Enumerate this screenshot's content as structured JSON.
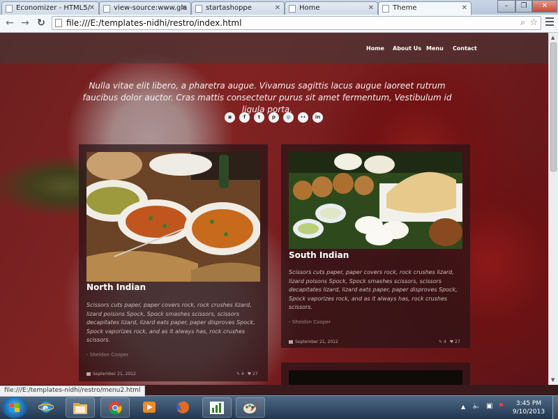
{
  "browser": {
    "tabs": [
      {
        "title": "Economizer - HTML5/"
      },
      {
        "title": "view-source:www.gla"
      },
      {
        "title": "startashoppe"
      },
      {
        "title": "Home"
      },
      {
        "title": "Theme"
      }
    ],
    "address": "file:///E:/templates-nidhi/restro/index.html",
    "status_url": "file:///E:/templates-nidhi/restro/menu2.html"
  },
  "site": {
    "nav": [
      "Home",
      "About Us",
      "Menu",
      "Contact"
    ],
    "tagline": "Nulla vitae elit libero, a pharetra augue. Vivamus sagittis lacus augue laoreet rutrum faucibus dolor auctor. Cras mattis consectetur purus sit amet fermentum, Vestibulum id ligula porta.",
    "social": [
      {
        "icon": "rss-icon",
        "glyph": "◉"
      },
      {
        "icon": "facebook-icon",
        "glyph": "f"
      },
      {
        "icon": "twitter-icon",
        "glyph": "t"
      },
      {
        "icon": "pinterest-icon",
        "glyph": "p"
      },
      {
        "icon": "dribbble-icon",
        "glyph": "◎"
      },
      {
        "icon": "flickr-icon",
        "glyph": "••"
      },
      {
        "icon": "linkedin-icon",
        "glyph": "in"
      }
    ],
    "cards": [
      {
        "title": "North Indian",
        "body": "Scissors cuts paper, paper covers rock, rock crushes lizard, lizard poisons Spock, Spock smashes scissors, scissors decapitates lizard, lizard eats paper, paper disproves Spock, Spock vaporizes rock, and as it always has, rock crushes scissors.",
        "author": "- Sheldon Cooper",
        "date": "September 21, 2012",
        "comments": "4",
        "likes": "27"
      },
      {
        "title": "South Indian",
        "body": "Scissors cuts paper, paper covers rock, rock crushes lizard, lizard poisons Spock, Spock smashes scissors, scissors decapitates lizard, lizard eats paper, paper disproves Spock, Spock vaporizes rock, and as it always has, rock crushes scissors.",
        "author": "- Sheldon Cooper",
        "date": "September 21, 2012",
        "comments": "4",
        "likes": "27"
      }
    ]
  },
  "taskbar": {
    "time": "3:45 PM",
    "date": "9/10/2013"
  }
}
